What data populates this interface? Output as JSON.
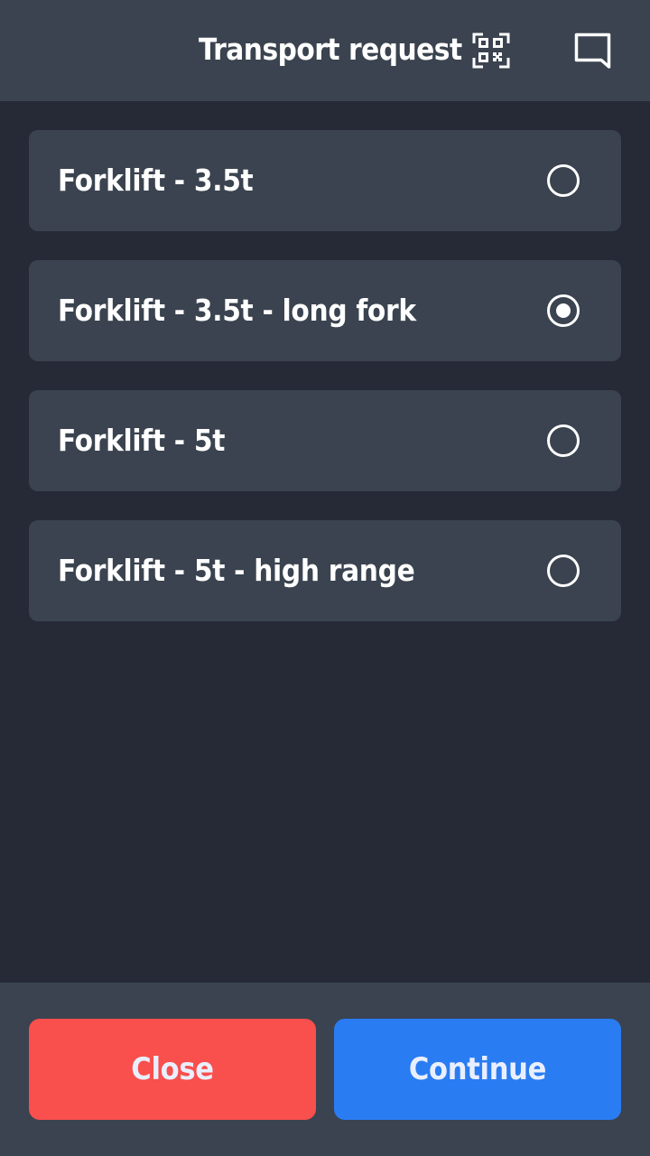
{
  "header": {
    "title": "Transport request",
    "qr_icon": "qr-code-icon",
    "chat_icon": "chat-icon"
  },
  "options": [
    {
      "label": "Forklift - 3.5t",
      "selected": false
    },
    {
      "label": "Forklift - 3.5t - long fork",
      "selected": true
    },
    {
      "label": "Forklift - 5t",
      "selected": false
    },
    {
      "label": "Forklift - 5t - high range",
      "selected": false
    }
  ],
  "footer": {
    "close_label": "Close",
    "continue_label": "Continue"
  },
  "colors": {
    "background": "#252a36",
    "panel": "#3a434f",
    "close": "#f94f4d",
    "continue": "#2a7cf2",
    "text": "#ffffff"
  }
}
